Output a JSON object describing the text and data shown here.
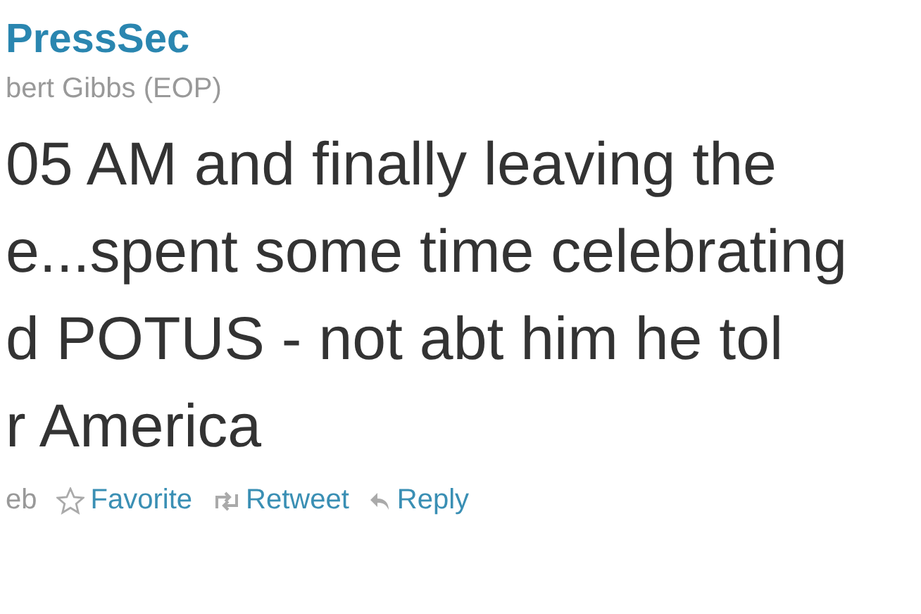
{
  "tweet": {
    "handle": "PressSec",
    "name": "bert Gibbs (EOP)",
    "lines": [
      "05 AM and finally leaving the",
      "e...spent some time celebrating",
      "d POTUS - not abt him he tol",
      "r America"
    ],
    "date": "eb",
    "actions": [
      {
        "kind": "favorite",
        "label": "Favorite"
      },
      {
        "kind": "retweet",
        "label": "Retweet"
      },
      {
        "kind": "reply",
        "label": "Reply"
      }
    ]
  }
}
